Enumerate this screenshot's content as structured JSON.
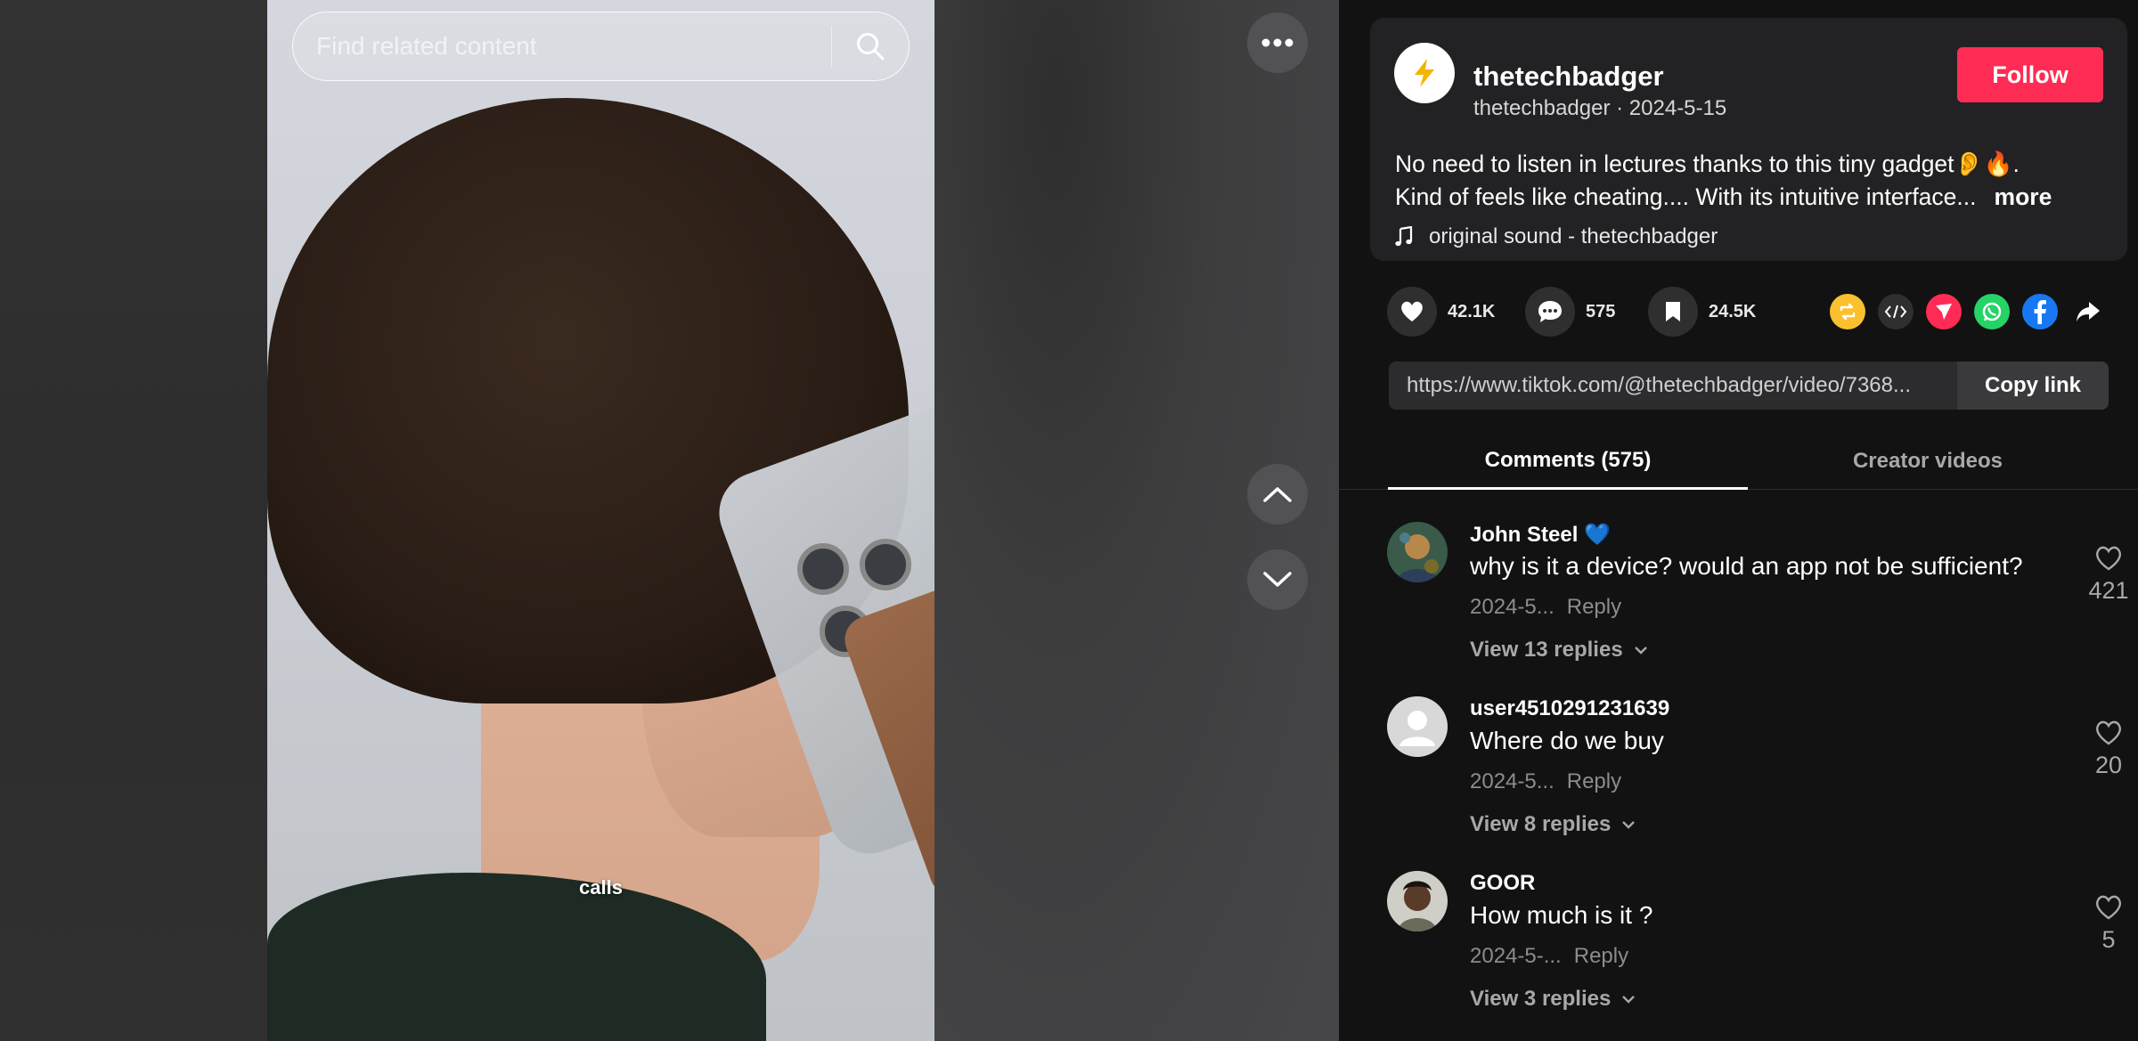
{
  "search": {
    "placeholder": "Find related content"
  },
  "video": {
    "caption": "calls"
  },
  "author": {
    "name": "thetechbadger",
    "handle": "thetechbadger",
    "date": "2024-5-15",
    "follow_label": "Follow"
  },
  "description": {
    "line1": "No need to listen in lectures thanks to this tiny gadget👂🔥.",
    "line2": "Kind of feels like cheating.... With its intuitive interface...",
    "more_label": "more",
    "sound": "original sound - thetechbadger"
  },
  "actions": {
    "likes": "42.1K",
    "comments": "575",
    "saves": "24.5K"
  },
  "share_icons": [
    "repost-icon",
    "embed-icon",
    "send-icon",
    "whatsapp-icon",
    "facebook-icon",
    "share-arrow-icon"
  ],
  "colors": {
    "accent": "#fe2c55",
    "repost": "#fbc02d",
    "whatsapp": "#25d366",
    "facebook": "#1877f2"
  },
  "link": {
    "url": "https://www.tiktok.com/@thetechbadger/video/7368...",
    "copy_label": "Copy link"
  },
  "tabs": {
    "comments": "Comments (575)",
    "creator": "Creator videos"
  },
  "comments": [
    {
      "name": "John Steel 💙",
      "text": "why is it a device? would an app not be sufficient?",
      "date": "2024-5...",
      "reply": "Reply",
      "view_replies": "View 13 replies",
      "likes": "421"
    },
    {
      "name": "user4510291231639",
      "text": "Where do we buy",
      "date": "2024-5...",
      "reply": "Reply",
      "view_replies": "View 8 replies",
      "likes": "20"
    },
    {
      "name": "GOOR",
      "text": "How much is it ?",
      "date": "2024-5-...",
      "reply": "Reply",
      "view_replies": "View 3 replies",
      "likes": "5"
    }
  ]
}
